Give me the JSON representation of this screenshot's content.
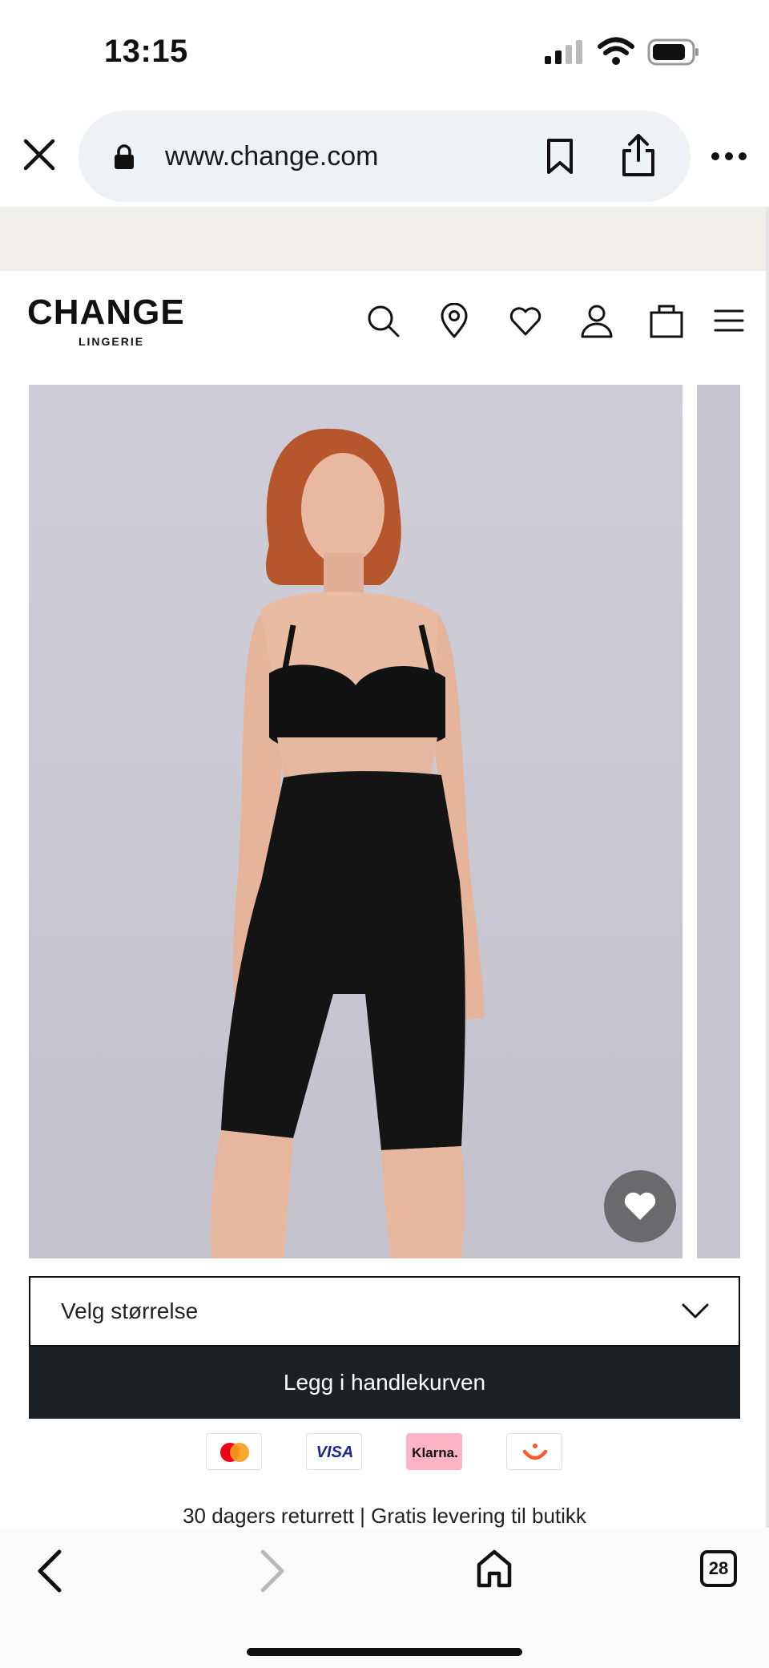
{
  "status_bar": {
    "time": "13:15"
  },
  "browser": {
    "url": "www.change.com",
    "tab_count": "28"
  },
  "brand": {
    "name": "CHANGE",
    "tagline": "LINGERIE"
  },
  "header_icons": [
    "search-icon",
    "store-locator-icon",
    "wishlist-icon",
    "account-icon",
    "cart-icon",
    "menu-icon"
  ],
  "product": {
    "size_placeholder": "Velg størrelse",
    "add_to_cart_label": "Legg i handlekurven"
  },
  "payments": {
    "visa": "VISA",
    "klarna": "Klarna."
  },
  "usp_text": "30 dagers returrett | Gratis levering til butikk",
  "colors": {
    "cta": "#1e2124",
    "promo_band": "#f0eeea",
    "klarna_pink": "#ffb3c7",
    "url_pill": "#eef2f4"
  }
}
